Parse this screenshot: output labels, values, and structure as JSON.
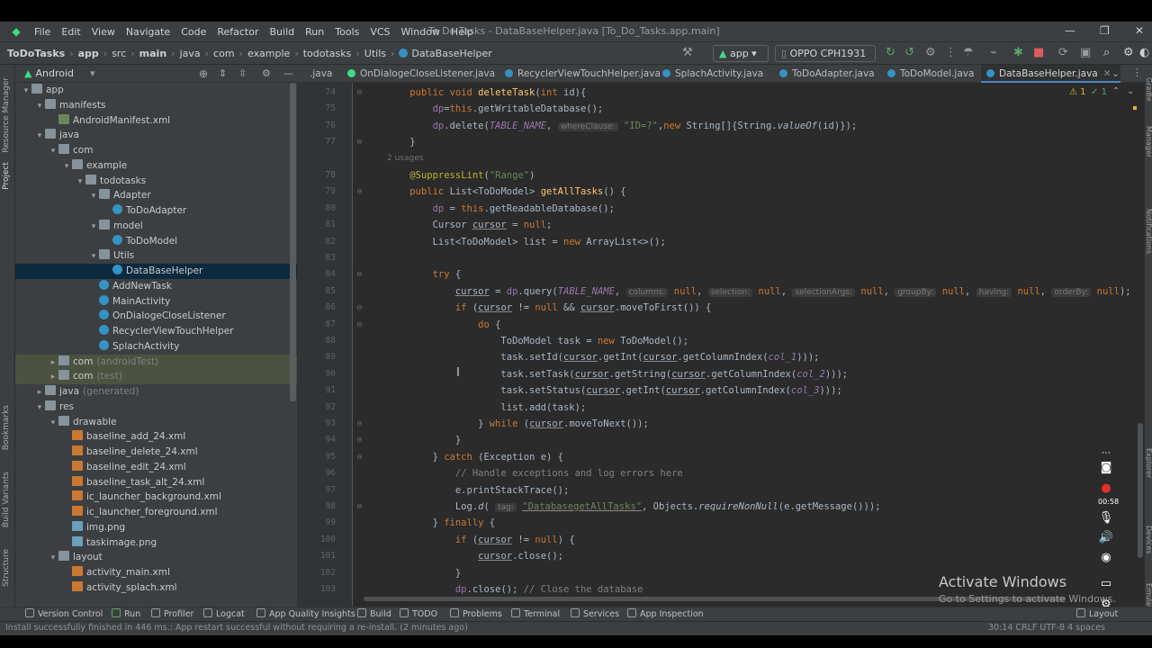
{
  "menubar": {
    "items": [
      "File",
      "Edit",
      "View",
      "Navigate",
      "Code",
      "Refactor",
      "Build",
      "Run",
      "Tools",
      "VCS",
      "Window",
      "Help"
    ],
    "window_title": "To Do Tasks - DataBaseHelper.java [To_Do_Tasks.app.main]"
  },
  "breadcrumb": [
    "ToDoTasks",
    "app",
    "src",
    "main",
    "java",
    "com",
    "example",
    "todotasks",
    "Utils",
    "DataBaseHelper"
  ],
  "toolbar": {
    "run_config": "app",
    "device": "OPPO CPH1931"
  },
  "project_panel": {
    "view": "Android",
    "tree": [
      {
        "label": "app",
        "indent": 0,
        "arrow": "▾",
        "icon": "folder"
      },
      {
        "label": "manifests",
        "indent": 1,
        "arrow": "▾",
        "icon": "folder"
      },
      {
        "label": "AndroidManifest.xml",
        "indent": 2,
        "arrow": "",
        "icon": "android"
      },
      {
        "label": "java",
        "indent": 1,
        "arrow": "▾",
        "icon": "folder"
      },
      {
        "label": "com",
        "indent": 2,
        "arrow": "▾",
        "icon": "folder"
      },
      {
        "label": "example",
        "indent": 3,
        "arrow": "▾",
        "icon": "folder"
      },
      {
        "label": "todotasks",
        "indent": 4,
        "arrow": "▾",
        "icon": "folder"
      },
      {
        "label": "Adapter",
        "indent": 5,
        "arrow": "▾",
        "icon": "folder"
      },
      {
        "label": "ToDoAdapter",
        "indent": 6,
        "arrow": "",
        "icon": "class"
      },
      {
        "label": "model",
        "indent": 5,
        "arrow": "▾",
        "icon": "folder"
      },
      {
        "label": "ToDoModel",
        "indent": 6,
        "arrow": "",
        "icon": "class"
      },
      {
        "label": "Utils",
        "indent": 5,
        "arrow": "▾",
        "icon": "folder"
      },
      {
        "label": "DataBaseHelper",
        "indent": 6,
        "arrow": "",
        "icon": "class",
        "selected": true
      },
      {
        "label": "AddNewTask",
        "indent": 5,
        "arrow": "",
        "icon": "class"
      },
      {
        "label": "MainActivity",
        "indent": 5,
        "arrow": "",
        "icon": "class"
      },
      {
        "label": "OnDialogeCloseListener",
        "indent": 5,
        "arrow": "",
        "icon": "class"
      },
      {
        "label": "RecyclerViewTouchHelper",
        "indent": 5,
        "arrow": "",
        "icon": "class"
      },
      {
        "label": "SplachActivity",
        "indent": 5,
        "arrow": "",
        "icon": "class"
      },
      {
        "label": "com",
        "suffix": "(androidTest)",
        "indent": 2,
        "arrow": "▸",
        "icon": "folder",
        "dim": true
      },
      {
        "label": "com",
        "suffix": "(test)",
        "indent": 2,
        "arrow": "▸",
        "icon": "folder",
        "dim": true
      },
      {
        "label": "java",
        "suffix": "(generated)",
        "indent": 1,
        "arrow": "▸",
        "icon": "folder"
      },
      {
        "label": "res",
        "indent": 1,
        "arrow": "▾",
        "icon": "folder"
      },
      {
        "label": "drawable",
        "indent": 2,
        "arrow": "▾",
        "icon": "folder"
      },
      {
        "label": "baseline_add_24.xml",
        "indent": 3,
        "arrow": "",
        "icon": "xml"
      },
      {
        "label": "baseline_delete_24.xml",
        "indent": 3,
        "arrow": "",
        "icon": "xml"
      },
      {
        "label": "baseline_edit_24.xml",
        "indent": 3,
        "arrow": "",
        "icon": "xml"
      },
      {
        "label": "baseline_task_alt_24.xml",
        "indent": 3,
        "arrow": "",
        "icon": "xml"
      },
      {
        "label": "ic_launcher_background.xml",
        "indent": 3,
        "arrow": "",
        "icon": "xml"
      },
      {
        "label": "ic_launcher_foreground.xml",
        "indent": 3,
        "arrow": "",
        "icon": "xml"
      },
      {
        "label": "img.png",
        "indent": 3,
        "arrow": "",
        "icon": "png"
      },
      {
        "label": "taskimage.png",
        "indent": 3,
        "arrow": "",
        "icon": "png"
      },
      {
        "label": "layout",
        "indent": 2,
        "arrow": "▾",
        "icon": "folder"
      },
      {
        "label": "activity_main.xml",
        "indent": 3,
        "arrow": "",
        "icon": "xml"
      },
      {
        "label": "activity_splach.xml",
        "indent": 3,
        "arrow": "",
        "icon": "xml"
      }
    ]
  },
  "left_strip_labels": [
    "Resource Manager",
    "Project",
    "Bookmarks",
    "Build Variants",
    "Structure"
  ],
  "editor_tabs": [
    {
      "label": ".java",
      "color": ""
    },
    {
      "label": "OnDialogeCloseListener.java",
      "color": "#3ddc84"
    },
    {
      "label": "RecyclerViewTouchHelper.java",
      "color": "#3592c4"
    },
    {
      "label": "SplachActivity.java",
      "color": "#3592c4"
    },
    {
      "label": "ToDoAdapter.java",
      "color": "#3592c4"
    },
    {
      "label": "ToDoModel.java",
      "color": "#3592c4"
    },
    {
      "label": "DataBaseHelper.java",
      "color": "#3592c4",
      "active": true
    }
  ],
  "inspection": {
    "warnings": "1",
    "weak": "1"
  },
  "code": {
    "usages_label": "2 usages",
    "lines": [
      {
        "no": "74",
        "html": "    <span class='k'>public void </span><span class='f'>deleteTask</span>(<span class='k'>int </span>id){"
      },
      {
        "no": "75",
        "html": "        <span class='const' style='font-style:normal'>dp</span>=<span class='k'>this</span>.getWritableDatabase();"
      },
      {
        "no": "76",
        "html": "        <span class='const' style='font-style:normal'>dp</span>.delete(<span class='const'>TABLE_NAME</span>, <span class='hint'>whereClause:</span> <span class='s'>\"ID=?\"</span>,<span class='k'>new </span>String[]{String.<span class='ital'>valueOf</span>(id)});"
      },
      {
        "no": "77",
        "html": "    }"
      },
      {
        "no": "78",
        "html": "    <span class='ann'>@SuppressLint</span>(<span class='s'>\"Range\"</span>)"
      },
      {
        "no": "79",
        "html": "    <span class='k'>public </span>List&lt;ToDoModel&gt; <span class='f'>getAllTasks</span>() {"
      },
      {
        "no": "80",
        "html": "        <span class='const' style='font-style:normal'>dp</span> = <span class='k'>this</span>.getReadableDatabase();"
      },
      {
        "no": "81",
        "html": "        Cursor <span class='ul'>cursor</span> = <span class='k'>null</span>;"
      },
      {
        "no": "82",
        "html": "        List&lt;ToDoModel&gt; list = <span class='k'>new </span>ArrayList&lt;&gt;();"
      },
      {
        "no": "83",
        "html": ""
      },
      {
        "no": "84",
        "html": "        <span class='k'>try </span>{"
      },
      {
        "no": "85",
        "html": "            <span class='ul'>cursor</span> = <span class='const' style='font-style:normal'>dp</span>.query(<span class='const'>TABLE_NAME</span>, <span class='hint'>columns:</span> <span class='k'>null</span>, <span class='hint'>selection:</span> <span class='k'>null</span>, <span class='hint'>selectionArgs:</span> <span class='k'>null</span>, <span class='hint'>groupBy:</span> <span class='k'>null</span>, <span class='hint'>having:</span> <span class='k'>null</span>, <span class='hint'>orderBy:</span> <span class='k'>null</span>);"
      },
      {
        "no": "86",
        "html": "            <span class='k'>if </span>(<span class='ul'>cursor</span> != <span class='k'>null </span>&amp;&amp; <span class='ul'>cursor</span>.moveToFirst()) {"
      },
      {
        "no": "87",
        "html": "                <span class='k'>do </span>{"
      },
      {
        "no": "88",
        "html": "                    ToDoModel task = <span class='k'>new </span>ToDoModel();"
      },
      {
        "no": "89",
        "html": "                    task.setId(<span class='ul'>cursor</span>.getInt(<span class='ul'>cursor</span>.getColumnIndex(<span class='const'>col_1</span>)));"
      },
      {
        "no": "90",
        "html": "                    task.setTask(<span class='ul'>cursor</span>.getString(<span class='ul'>cursor</span>.getColumnIndex(<span class='const'>col_2</span>)));"
      },
      {
        "no": "91",
        "html": "                    task.setStatus(<span class='ul'>cursor</span>.getInt(<span class='ul'>cursor</span>.getColumnIndex(<span class='const'>col_3</span>)));"
      },
      {
        "no": "92",
        "html": "                    list.add(task);"
      },
      {
        "no": "93",
        "html": "                } <span class='k'>while </span>(<span class='ul'>cursor</span>.moveToNext());"
      },
      {
        "no": "94",
        "html": "            }"
      },
      {
        "no": "95",
        "html": "        } <span class='k'>catch </span>(Exception e) {"
      },
      {
        "no": "96",
        "html": "            <span class='c'>// Handle exceptions and log errors here</span>"
      },
      {
        "no": "97",
        "html": "            e.printStackTrace();"
      },
      {
        "no": "98",
        "html": "            Log.<span class='ital'>d</span>( <span class='hint'>tag:</span> <span class='s ul'>\"DatabasegetAllTasks\"</span>, Objects.<span class='ital'>requireNonNull</span>(e.getMessage()));"
      },
      {
        "no": "99",
        "html": "        } <span class='k'>finally </span>{"
      },
      {
        "no": "100",
        "html": "            <span class='k'>if </span>(<span class='ul'>cursor</span> != <span class='k'>null</span>) {"
      },
      {
        "no": "101",
        "html": "                <span class='ul'>cursor</span>.close();"
      },
      {
        "no": "102",
        "html": "            }"
      },
      {
        "no": "103",
        "html": "            <span class='const' style='font-style:normal'>dp</span>.close(); <span class='c'>// Close the database</span>"
      }
    ]
  },
  "right_strip_labels": [
    "Gradle",
    "Device Manager",
    "Notifications",
    "Device Explorer",
    "Running Devices",
    "Emulator"
  ],
  "recorder": {
    "time": "00:58"
  },
  "watermark": {
    "line1": "Activate Windows",
    "line2": "Go to Settings to activate Windows."
  },
  "tool_windows": [
    "Version Control",
    "Run",
    "Profiler",
    "Logcat",
    "App Quality Insights",
    "Build",
    "TODO",
    "Problems",
    "Terminal",
    "Services",
    "App Inspection",
    "Layout Inspector"
  ],
  "status": {
    "message": "Install successfully finished in 446 ms.: App restart successful without requiring a re-install. (2 minutes ago)",
    "right": "30:14   CRLF   UTF-8   4 spaces"
  }
}
